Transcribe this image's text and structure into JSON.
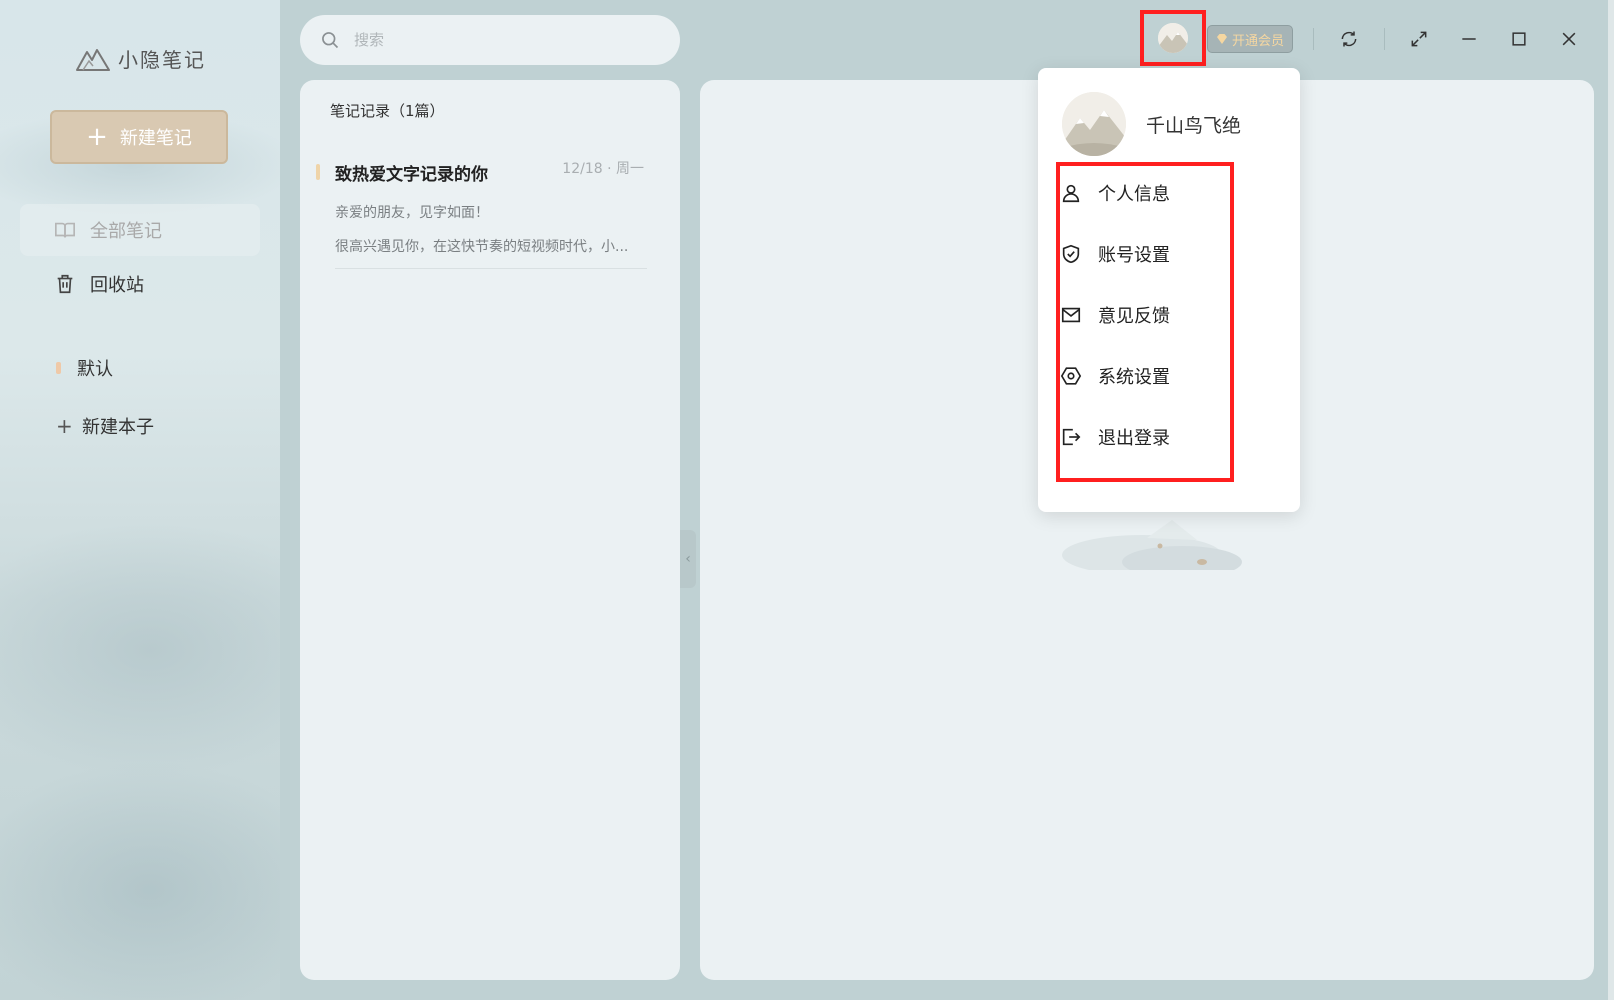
{
  "app": {
    "name": "小隐笔记"
  },
  "sidebar": {
    "new_note_label": "新建笔记",
    "nav": [
      {
        "label": "全部笔记",
        "icon": "book-open-icon"
      },
      {
        "label": "回收站",
        "icon": "trash-icon"
      }
    ],
    "notebooks": [
      {
        "label": "默认",
        "color": "#efc9a8"
      }
    ],
    "new_notebook_label": "新建本子"
  },
  "search": {
    "placeholder": "搜索"
  },
  "topbar": {
    "vip_label": "开通会员",
    "icons": [
      "sync-icon",
      "fullscreen-icon",
      "minimize-icon",
      "maximize-icon",
      "close-icon"
    ]
  },
  "notes": {
    "header": "笔记记录（1篇）",
    "items": [
      {
        "title": "致热爱文字记录的你",
        "date": "12/18 · 周一",
        "line1": "亲爱的朋友，见字如面！",
        "line2": "很高兴遇见你，在这快节奏的短视频时代，小..."
      }
    ]
  },
  "user_menu": {
    "username": "千山鸟飞绝",
    "items": [
      {
        "label": "个人信息",
        "icon": "user-icon"
      },
      {
        "label": "账号设置",
        "icon": "shield-check-icon"
      },
      {
        "label": "意见反馈",
        "icon": "mail-icon"
      },
      {
        "label": "系统设置",
        "icon": "settings-hex-icon"
      },
      {
        "label": "退出登录",
        "icon": "logout-icon"
      }
    ]
  },
  "colors": {
    "accent_highlight": "#ff1f1f",
    "new_note_button": "#d9c9b2",
    "vip_text": "#f5d7a1",
    "panel_bg": "#ebf1f3"
  }
}
